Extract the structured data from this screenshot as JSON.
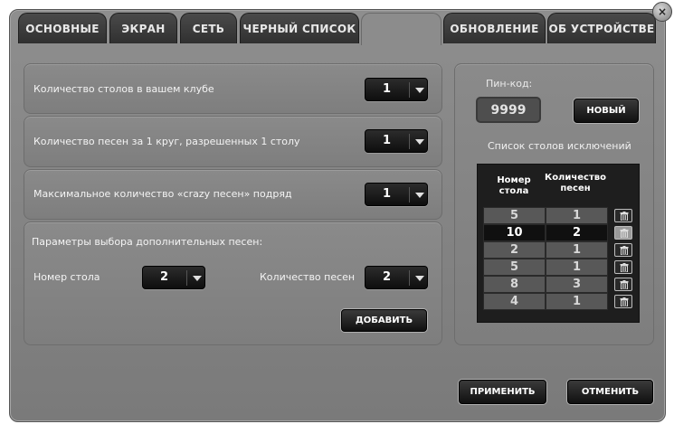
{
  "tabs": [
    {
      "label": "ОСНОВНЫЕ"
    },
    {
      "label": "ЭКРАН"
    },
    {
      "label": "СЕТЬ"
    },
    {
      "label": "ЧЕРНЫЙ СПИСОК"
    },
    {
      "label": ""
    },
    {
      "label": "ОБНОВЛЕНИЕ"
    },
    {
      "label": "ОБ УСТРОЙСТВЕ"
    }
  ],
  "settings": {
    "tables_count": {
      "label": "Количество столов в вашем клубе",
      "value": "1"
    },
    "songs_per_round": {
      "label": "Количество песен за 1 круг, разрешенных 1 столу",
      "value": "1"
    },
    "max_crazy": {
      "label": "Максимальное количество «crazy песен» подряд",
      "value": "1"
    },
    "extra": {
      "title": "Параметры выбора дополнительных песен:",
      "table_label": "Номер стола",
      "table_value": "2",
      "songs_label": "Количество песен",
      "songs_value": "2",
      "add_button": "ДОБАВИТЬ"
    }
  },
  "pin": {
    "label": "Пин-код:",
    "value": "9999",
    "new_button": "НОВЫЙ"
  },
  "exceptions": {
    "title": "Список столов исключений",
    "col1": "Номер стола",
    "col2": "Количество песен",
    "rows": [
      {
        "table": "5",
        "songs": "1"
      },
      {
        "table": "10",
        "songs": "2"
      },
      {
        "table": "2",
        "songs": "1"
      },
      {
        "table": "5",
        "songs": "1"
      },
      {
        "table": "8",
        "songs": "3"
      },
      {
        "table": "4",
        "songs": "1"
      }
    ],
    "highlighted_row": 1
  },
  "footer": {
    "apply_button": "ПРИМЕНИТЬ",
    "cancel_button": "ОТМЕНИТЬ"
  }
}
